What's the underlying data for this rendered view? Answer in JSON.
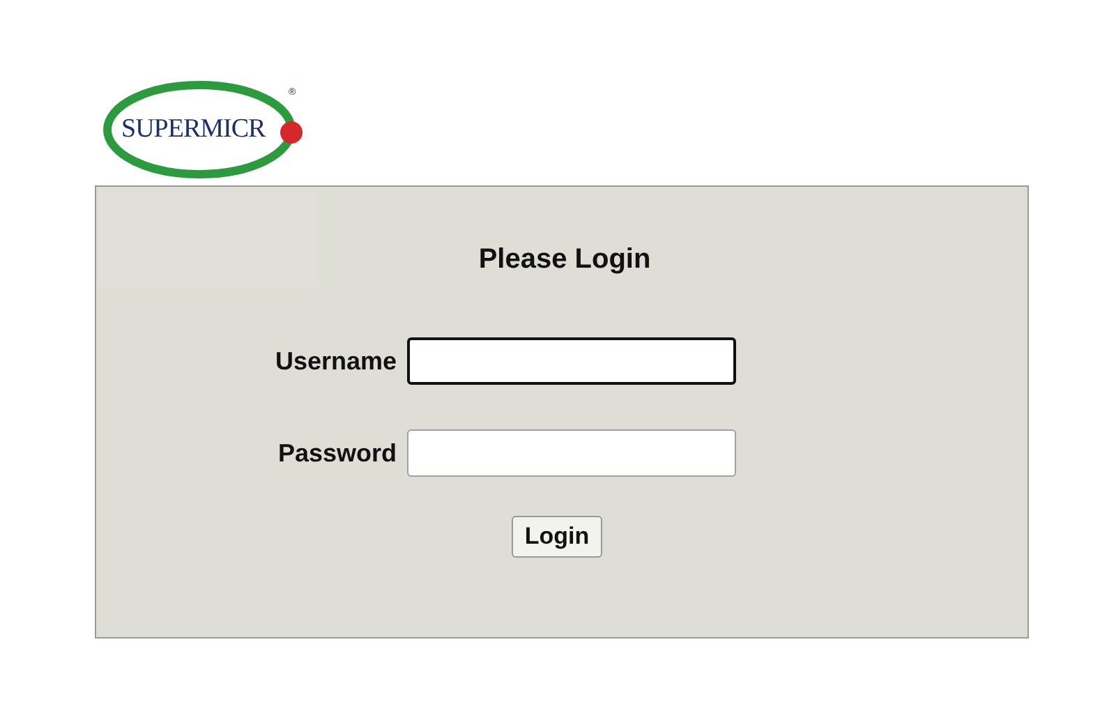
{
  "logo": {
    "text": "SUPERMICR",
    "mark": "®"
  },
  "login": {
    "title": "Please Login",
    "fields": [
      {
        "label": "Username",
        "focused": true
      },
      {
        "label": "Password",
        "focused": false
      }
    ],
    "button": "Login"
  }
}
